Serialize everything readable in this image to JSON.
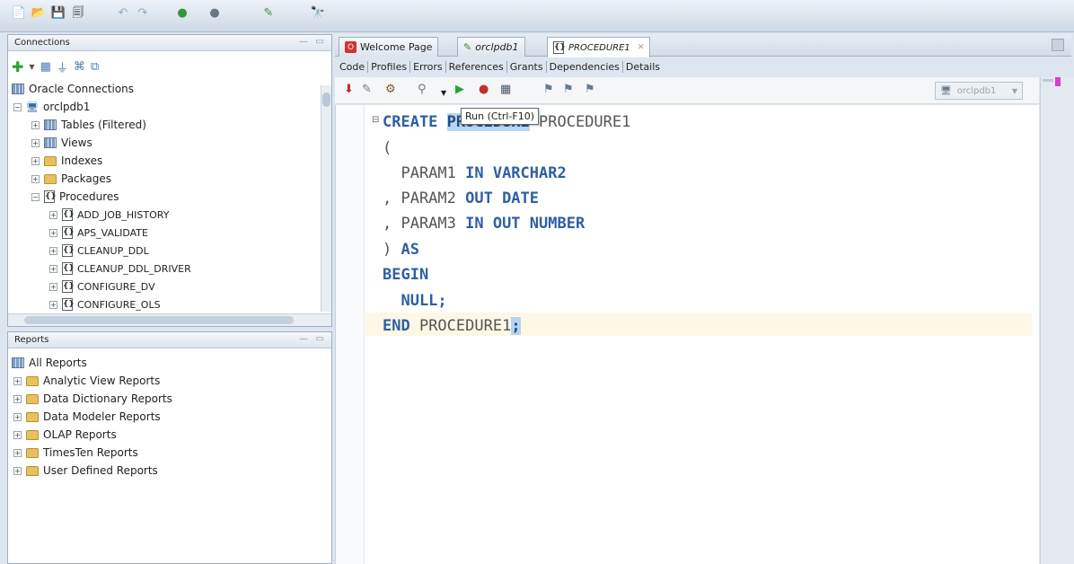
{
  "connections": {
    "title": "Connections",
    "root": "Oracle Connections",
    "connection": "orclpdb1",
    "nodes": [
      "Tables (Filtered)",
      "Views",
      "Indexes",
      "Packages",
      "Procedures"
    ],
    "procedures": [
      "ADD_JOB_HISTORY",
      "APS_VALIDATE",
      "CLEANUP_DDL",
      "CLEANUP_DDL_DRIVER",
      "CONFIGURE_DV",
      "CONFIGURE_OLS"
    ]
  },
  "reports": {
    "title": "Reports",
    "root": "All Reports",
    "items": [
      "Analytic View Reports",
      "Data Dictionary Reports",
      "Data Modeler Reports",
      "OLAP Reports",
      "TimesTen Reports",
      "User Defined Reports"
    ]
  },
  "tabs": [
    "Welcome Page",
    "orclpdb1",
    "PROCEDURE1"
  ],
  "subtabs": [
    "Code",
    "Profiles",
    "Errors",
    "References",
    "Grants",
    "Dependencies",
    "Details"
  ],
  "connection_selector": "orclpdb1",
  "tooltip": "Run (Ctrl-F10)",
  "code": {
    "l1a": "CREATE ",
    "l1b": "PROCEDURE",
    "l1c": " PROCEDURE1",
    "l2": "(",
    "l3a": "  PARAM1 ",
    "l3b": "IN VARCHAR2",
    "l4a": ", PARAM2 ",
    "l4b": "OUT DATE",
    "l5a": ", PARAM3 ",
    "l5b": "IN OUT NUMBER",
    "l6a": ") ",
    "l6b": "AS",
    "l7": "BEGIN",
    "l8": "  NULL;",
    "l9a": "END",
    "l9b": " PROCEDURE1",
    "l9c": ";"
  }
}
